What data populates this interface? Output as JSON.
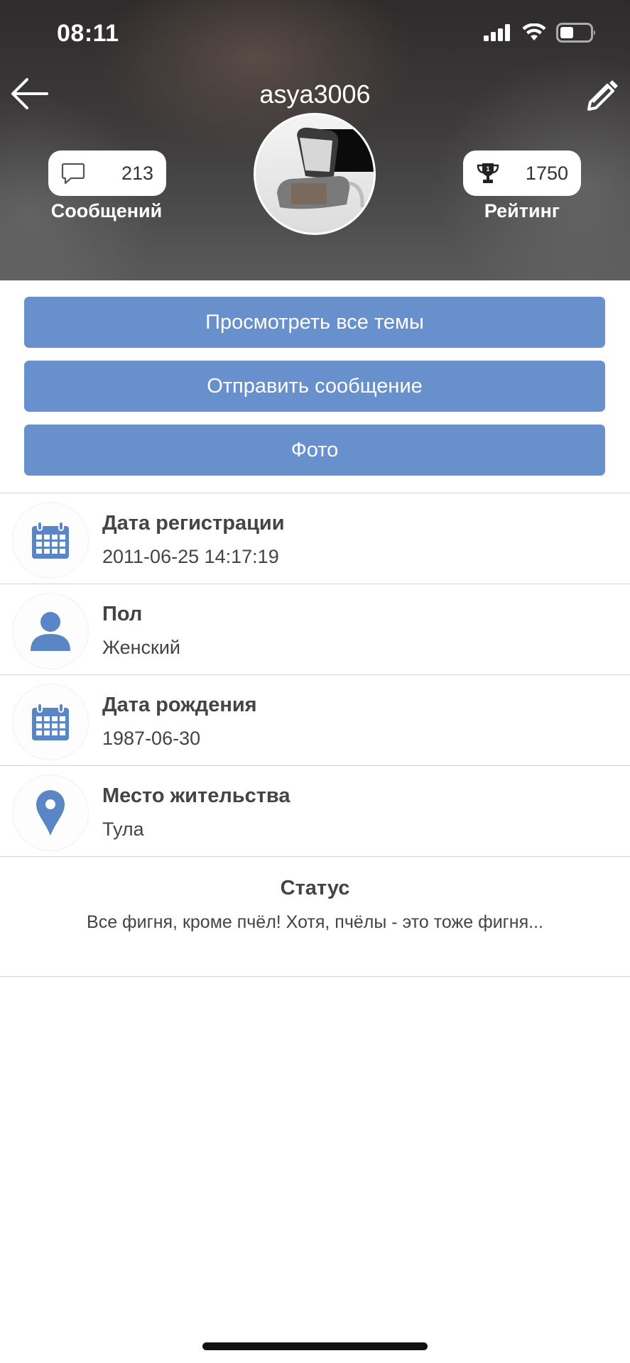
{
  "status_bar": {
    "time": "08:11",
    "icons": [
      "signal-icon",
      "wifi-icon",
      "battery-icon"
    ]
  },
  "header": {
    "username": "asya3006",
    "back_icon": "arrow-left-icon",
    "edit_icon": "pencil-icon",
    "stats": {
      "messages": {
        "value": "213",
        "label": "Сообщений",
        "icon": "speech-bubble-icon"
      },
      "rating": {
        "value": "1750",
        "label": "Рейтинг",
        "icon": "trophy-icon"
      }
    }
  },
  "actions": {
    "view_topics": "Просмотреть все темы",
    "send_message": "Отправить сообщение",
    "photo": "Фото"
  },
  "info": [
    {
      "icon": "calendar-icon",
      "title": "Дата регистрации",
      "value": "2011-06-25 14:17:19"
    },
    {
      "icon": "person-icon",
      "title": "Пол",
      "value": "Женский"
    },
    {
      "icon": "calendar-icon",
      "title": "Дата рождения",
      "value": "1987-06-30"
    },
    {
      "icon": "location-pin-icon",
      "title": "Место жительства",
      "value": "Тула"
    }
  ],
  "status": {
    "title": "Статус",
    "text": "Все фигня, кроме пчёл! Хотя, пчёлы - это тоже фигня..."
  },
  "colors": {
    "accent": "#6890cc",
    "divider": "#d3d3d3",
    "text": "#444444"
  }
}
